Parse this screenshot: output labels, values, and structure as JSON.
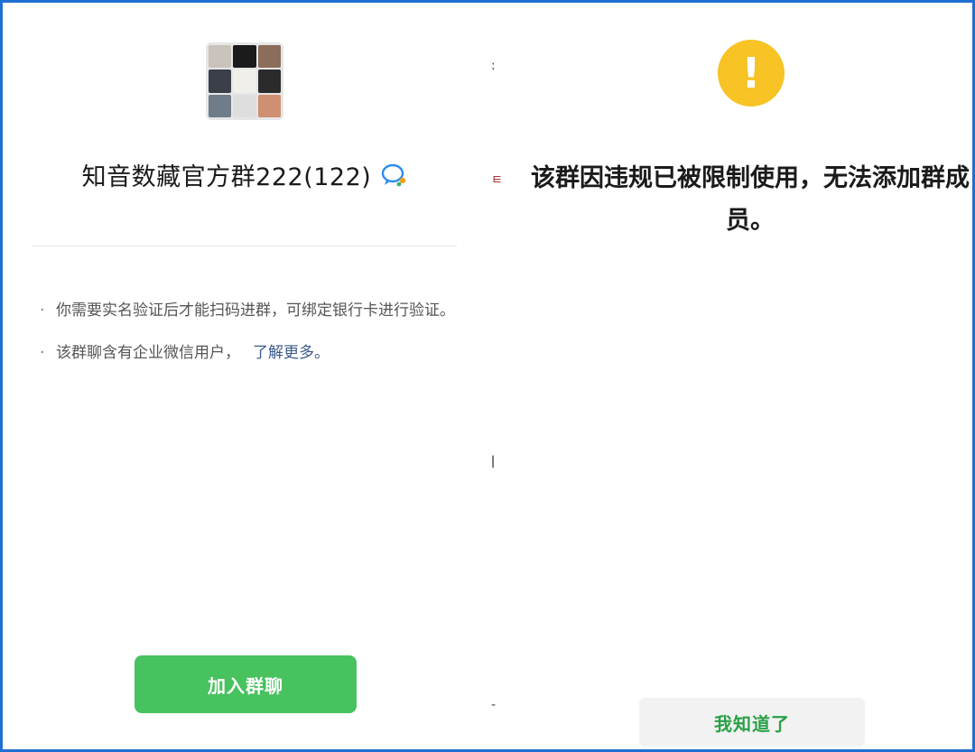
{
  "left_panel": {
    "avatar_colors": [
      "#c9c3bc",
      "#1b1b1b",
      "#8a6d5a",
      "#3a3f4a",
      "#f0efe9",
      "#2b2b2b",
      "#6f7c89",
      "#dedede",
      "#cf8f72"
    ],
    "group_name": "知音数藏官方群222(122)",
    "chat_icon": "chat-bubble-icon",
    "notes": [
      {
        "text": "你需要实名验证后才能扫码进群，可绑定银行卡进行验证。"
      },
      {
        "text": "该群聊含有企业微信用户，",
        "link": "了解更多。"
      }
    ],
    "join_button": "加入群聊"
  },
  "right_panel": {
    "warning_icon": "exclamation-icon",
    "warning_symbol": "!",
    "warning_color": "#f7c325",
    "message": "该群因违规已被限制使用，无法添加群成员。",
    "ok_button": "我知道了"
  },
  "theme": {
    "accent_green": "#48c15f",
    "frame_border": "#1f6fd1"
  }
}
